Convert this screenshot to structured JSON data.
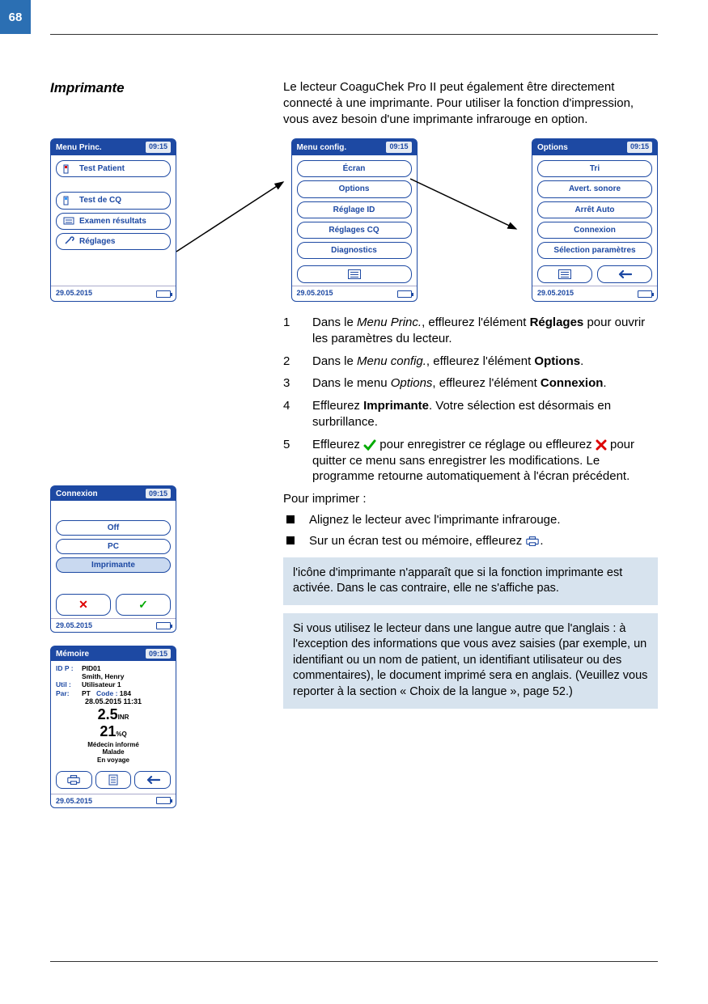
{
  "page_number": "68",
  "heading": "Imprimante",
  "intro": "Le lecteur CoaguChek Pro II peut également être directe­ment connecté à une imprimante. Pour utiliser la fonction d'impression, vous avez besoin d'une imprimante infra­rouge en option.",
  "device_common": {
    "time": "09:15",
    "date": "29.05.2015"
  },
  "dev_princ": {
    "title": "Menu Princ.",
    "btns": [
      "Test Patient",
      "Test de CQ",
      "Examen résultats",
      "Réglages"
    ]
  },
  "dev_config": {
    "title": "Menu config.",
    "btns": [
      "Écran",
      "Options",
      "Réglage ID",
      "Réglages CQ",
      "Diagnostics"
    ]
  },
  "dev_options": {
    "title": "Options",
    "btns": [
      "Tri",
      "Avert. sonore",
      "Arrêt Auto",
      "Connexion",
      "Sélection paramètres"
    ]
  },
  "dev_connexion": {
    "title": "Connexion",
    "btns": [
      "Off",
      "PC",
      "Imprimante"
    ]
  },
  "dev_memoire": {
    "title": "Mémoire",
    "idp_label": "ID P :",
    "idp": "PID01",
    "name": "Smith, Henry",
    "util_label": "Util :",
    "util": "Utilisateur 1",
    "par_label": "Par:",
    "par": "PT",
    "code_label": "Code :",
    "code": "184",
    "ts": "28.05.2015 11:31",
    "inr_val": "2.5",
    "inr_unit": "INR",
    "q_val": "21",
    "q_unit": "%Q",
    "notes": [
      "Médecin informé",
      "Malade",
      "En voyage"
    ]
  },
  "steps": [
    {
      "n": "1",
      "pre": "Dans le ",
      "em": "Menu Princ.",
      "mid": ", effleurez l'élément ",
      "b": "Réglages",
      "post": " pour ouvrir les paramètres du lecteur."
    },
    {
      "n": "2",
      "pre": "Dans le ",
      "em": "Menu config.",
      "mid": ", effleurez l'élément ",
      "b": "Options",
      "post": "."
    },
    {
      "n": "3",
      "pre": "Dans le menu ",
      "em": "Options",
      "mid": ", effleurez l'élément ",
      "b": "Connexion",
      "post": "."
    },
    {
      "n": "4",
      "pre": "Effleurez ",
      "em": "",
      "mid": "",
      "b": "Imprimante",
      "post": ". Votre sélection est désormais en surbrillance."
    }
  ],
  "step5": {
    "n": "5",
    "a": "Effleurez ",
    "b": " pour enregistrer ce réglage ou effleurez ",
    "c": " pour quitter ce menu sans enregistrer les modifications. Le programme retourne auto­matiquement à l'écran précédent."
  },
  "print_heading": "Pour imprimer :",
  "bullets": {
    "a": "Alignez le lecteur avec l'imprimante infrarouge.",
    "b_pre": "Sur un écran test ou mémoire, effleurez ",
    "b_post": "."
  },
  "note1": "l'icône d'imprimante n'apparaît que si la fonction imprimante est activée. Dans le cas contraire, elle ne s'affiche pas.",
  "note2": "Si vous utilisez le lecteur dans une langue autre que l'anglais : à l'exception des informations que vous avez saisies (par exemple, un identifiant ou un nom de patient, un identifiant utilisateur ou des commentaires), le document imprimé sera en anglais. (Veuillez vous reporter à la section « Choix de la langue », page 52.)"
}
